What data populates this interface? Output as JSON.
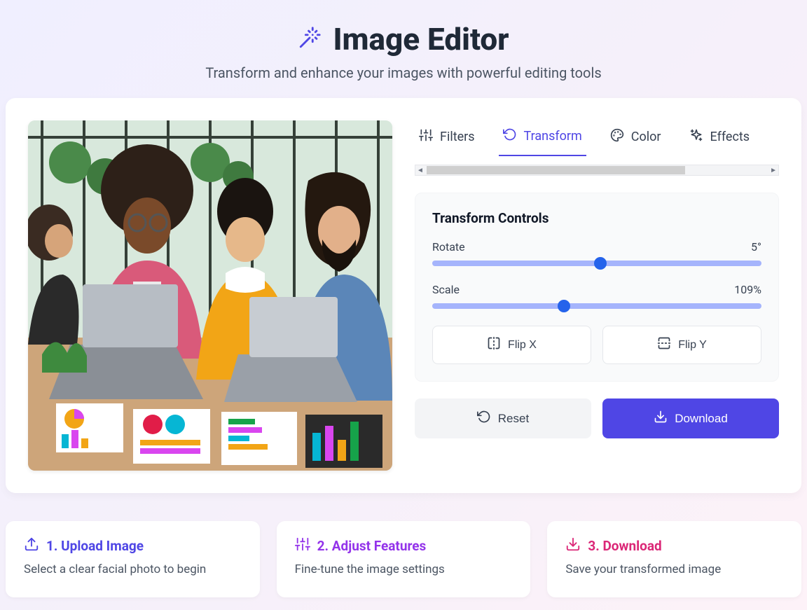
{
  "header": {
    "title": "Image Editor",
    "subtitle": "Transform and enhance your images with powerful editing tools"
  },
  "tabs": {
    "filters": "Filters",
    "transform": "Transform",
    "color": "Color",
    "effects": "Effects",
    "active": "transform"
  },
  "panel": {
    "title": "Transform Controls",
    "rotate_label": "Rotate",
    "rotate_value": "5°",
    "rotate_pct": 51,
    "scale_label": "Scale",
    "scale_value": "109%",
    "scale_pct": 40,
    "flip_x": "Flip X",
    "flip_y": "Flip Y"
  },
  "actions": {
    "reset": "Reset",
    "download": "Download"
  },
  "steps": {
    "s1_title": "1. Upload Image",
    "s1_body": "Select a clear facial photo to begin",
    "s2_title": "2. Adjust Features",
    "s2_body": "Fine-tune the image settings",
    "s3_title": "3. Download",
    "s3_body": "Save your transformed image"
  }
}
